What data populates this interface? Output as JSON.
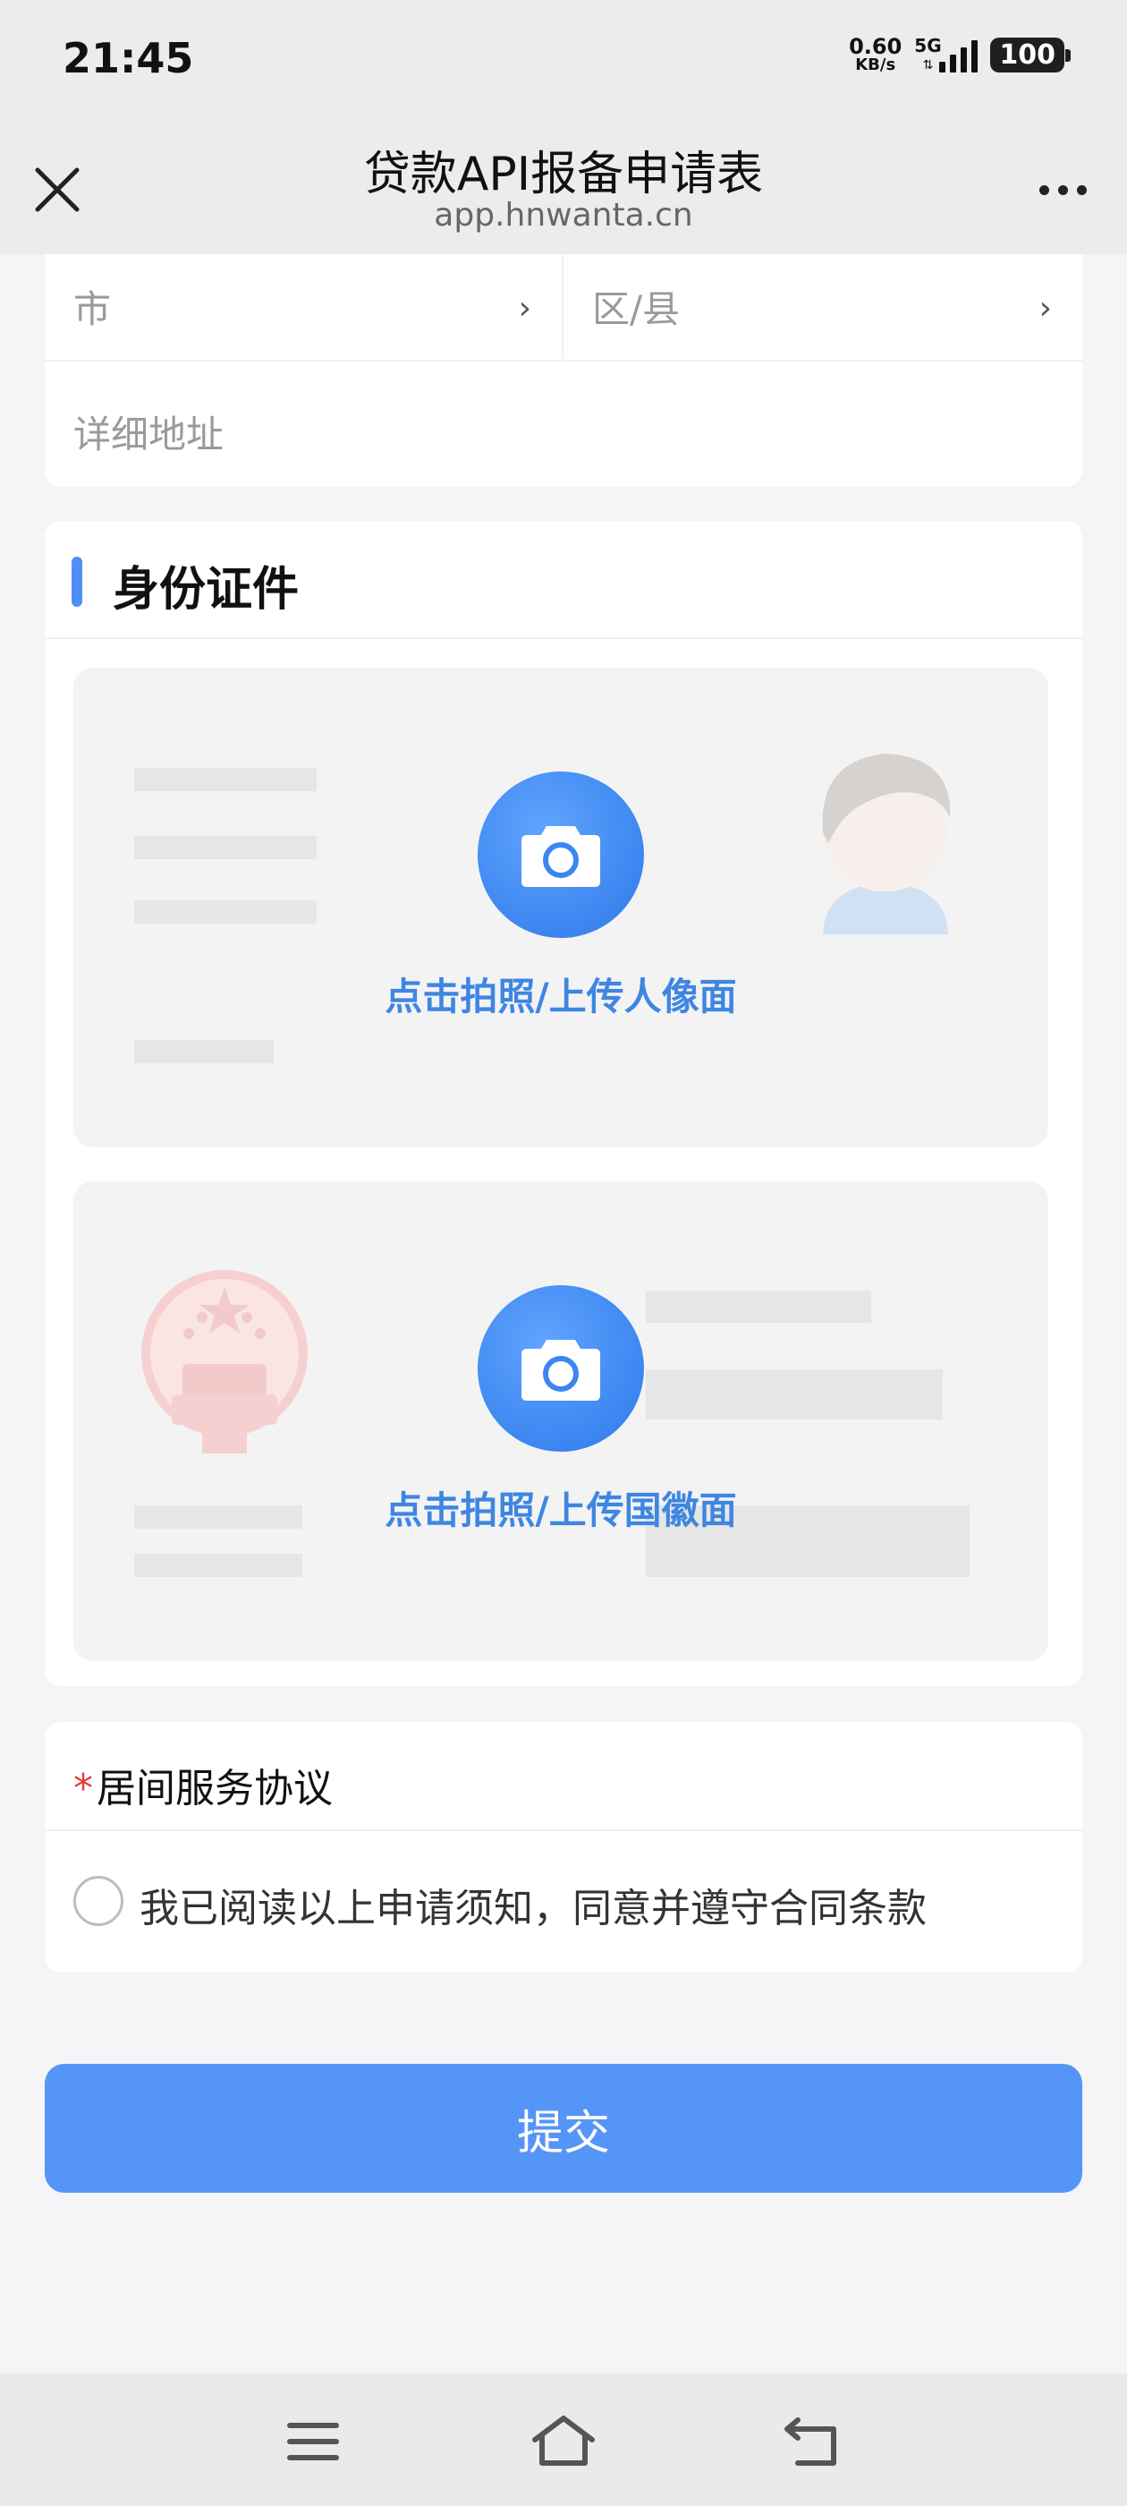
{
  "status_bar": {
    "time": "21:45",
    "net_speed_value": "0.60",
    "net_speed_unit": "KB/s",
    "network_type": "5G",
    "battery": "100"
  },
  "header": {
    "title": "贷款API报备申请表",
    "url": "app.hnwanta.cn"
  },
  "address": {
    "city_placeholder": "市",
    "district_placeholder": "区/县",
    "detail_placeholder": "详细地址"
  },
  "id_section": {
    "title": "身份证件",
    "portrait_label": "点击拍照/上传人像面",
    "emblem_label": "点击拍照/上传国徽面"
  },
  "agreement": {
    "required_mark": "*",
    "title": "居间服务协议",
    "checkbox_label": "我已阅读以上申请须知，同意并遵守合同条款",
    "checked": false
  },
  "submit_label": "提交",
  "colors": {
    "accent": "#5695f8",
    "link": "#3e86e2",
    "required": "#e53935"
  },
  "icons": {
    "close": "close-icon",
    "more": "more-icon",
    "camera": "camera-icon",
    "menu": "menu-icon",
    "home": "home-icon",
    "back": "back-icon"
  }
}
